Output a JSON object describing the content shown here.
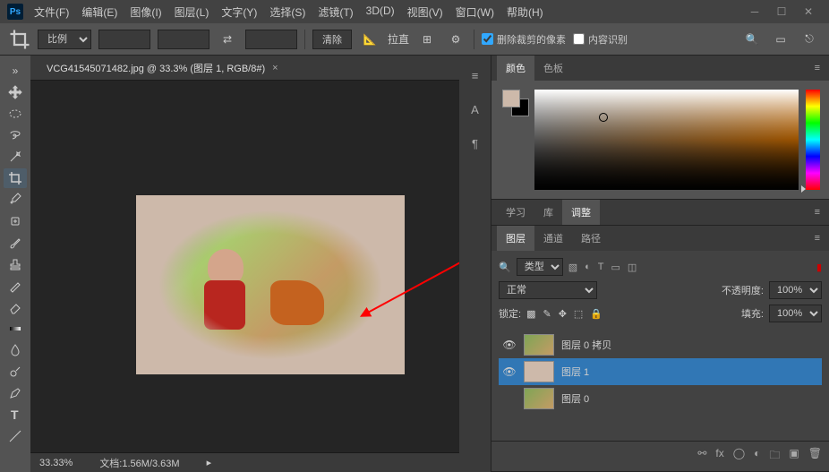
{
  "menu": [
    "文件(F)",
    "编辑(E)",
    "图像(I)",
    "图层(L)",
    "文字(Y)",
    "选择(S)",
    "滤镜(T)",
    "3D(D)",
    "视图(V)",
    "窗口(W)",
    "帮助(H)"
  ],
  "optbar": {
    "ratio": "比例",
    "clear": "清除",
    "straighten": "拉直",
    "delete_cropped": "删除裁剪的像素",
    "content_aware": "内容识别"
  },
  "doc": {
    "title": "VCG41545071482.jpg @ 33.3% (图层 1, RGB/8#)",
    "zoom": "33.33%",
    "docinfo_label": "文档:",
    "docinfo": "1.56M/3.63M"
  },
  "panels": {
    "color_tabs": [
      "颜色",
      "色板"
    ],
    "adj_tabs": [
      "学习",
      "库",
      "调整"
    ],
    "layer_tabs": [
      "图层",
      "通道",
      "路径"
    ],
    "kind_label": "类型",
    "blend_normal": "正常",
    "opacity_label": "不透明度:",
    "opacity_val": "100%",
    "lock_label": "锁定:",
    "fill_label": "填充:",
    "fill_val": "100%",
    "layers": [
      {
        "name": "图层 0 拷贝",
        "visible": true,
        "thumb": "t1"
      },
      {
        "name": "图层 1",
        "visible": true,
        "thumb": "t2",
        "selected": true
      },
      {
        "name": "图层 0",
        "visible": false,
        "thumb": "t3"
      }
    ]
  },
  "colors": {
    "fg": "#cdb9aa",
    "bg": "#000000"
  },
  "rail": [
    "≡",
    "A",
    "¶"
  ]
}
